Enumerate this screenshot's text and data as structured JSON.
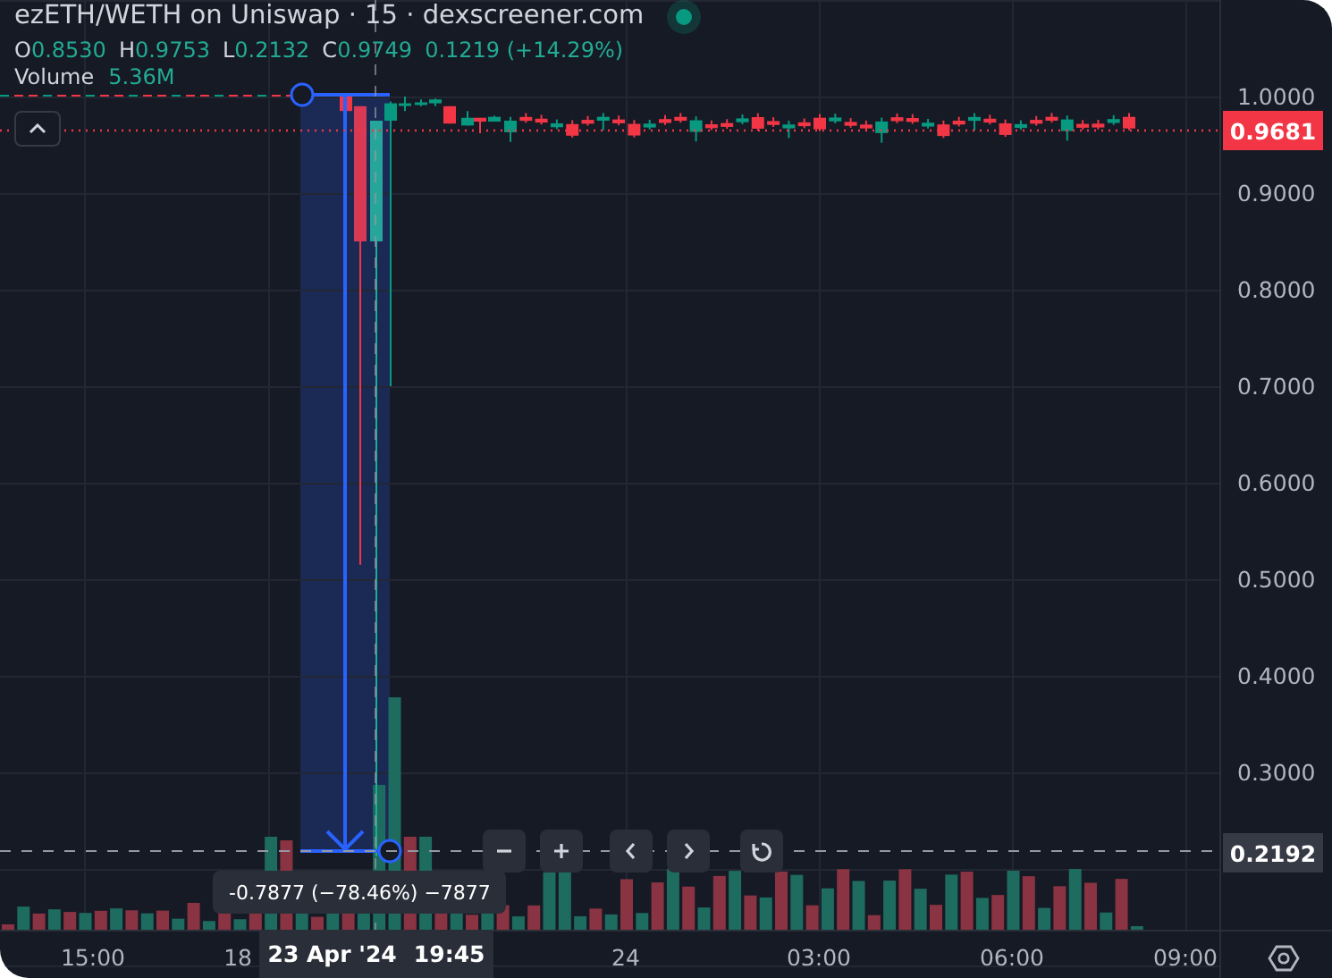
{
  "header": {
    "title": "ezETH/WETH on Uniswap · 15 · dexscreener.com",
    "live": true
  },
  "ohlc": [
    {
      "label": "O",
      "value": "0.8530"
    },
    {
      "label": "H",
      "value": "0.9753"
    },
    {
      "label": "L",
      "value": "0.2132"
    },
    {
      "label": "C",
      "value": "0.9749"
    }
  ],
  "change": "0.1219 (+14.29%)",
  "volume": {
    "label": "Volume",
    "value": "5.36M"
  },
  "price_axis": [
    "1.0000",
    "0.9000",
    "0.8000",
    "0.7000",
    "0.6000",
    "0.5000",
    "0.4000",
    "0.3000"
  ],
  "last_price": "0.9681",
  "crosshair_price": "0.2192",
  "measure": "-0.7877 (−78.46%) −7877",
  "time_axis": [
    "15:00",
    "18",
    "24",
    "03:00",
    "06:00",
    "09:00"
  ],
  "crosshair_time": {
    "date": "23 Apr '24",
    "time": "19:45"
  }
}
